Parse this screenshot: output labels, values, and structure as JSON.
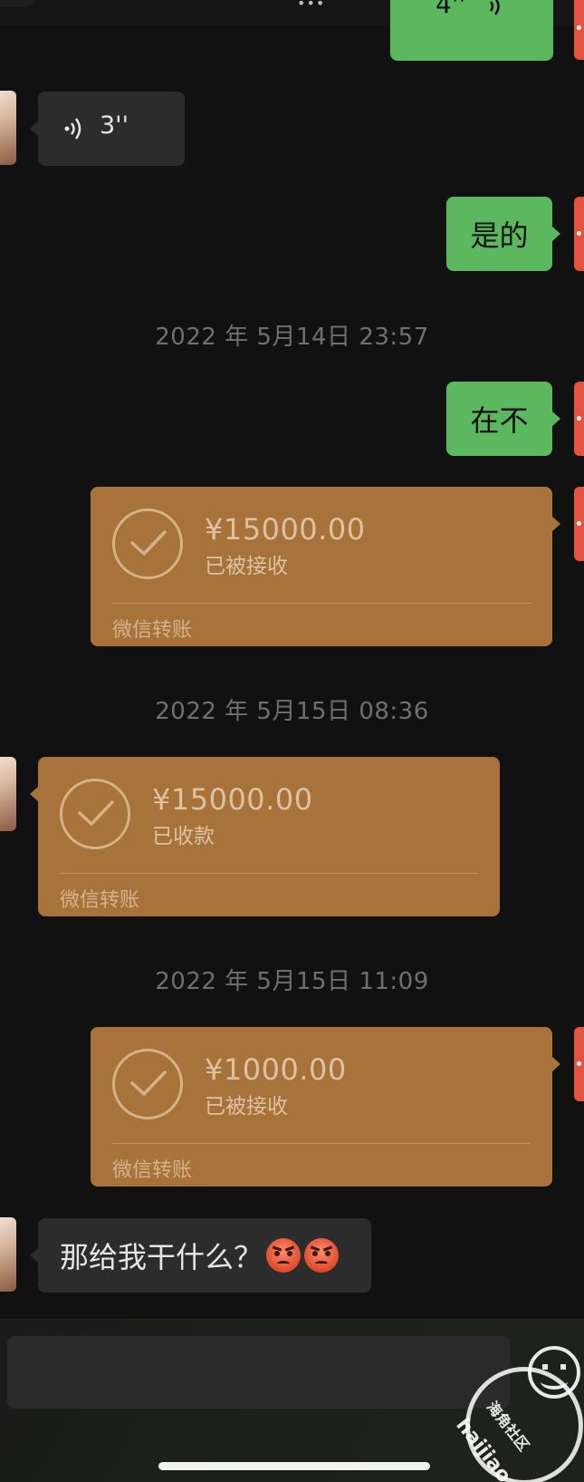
{
  "messages": {
    "top_partial": {
      "text": "4''"
    },
    "voice_in": {
      "duration": "3''"
    },
    "msg_shi_de": {
      "text": "是的"
    },
    "ts1": "2022 年 5月14日 23:57",
    "msg_zai_bu": {
      "text": "在不"
    },
    "transfer1": {
      "amount": "¥15000.00",
      "status": "已被接收",
      "label": "微信转账"
    },
    "ts2": "2022 年 5月15日 08:36",
    "transfer2": {
      "amount": "¥15000.00",
      "status": "已收款",
      "label": "微信转账"
    },
    "ts3": "2022 年 5月15日 11:09",
    "transfer3": {
      "amount": "¥1000.00",
      "status": "已被接收",
      "label": "微信转账"
    },
    "msg_last": {
      "text": "那给我干什么？"
    }
  },
  "watermark": {
    "site": "haijiao.com",
    "cn": "海角社区"
  },
  "icons": {
    "voice": "voice-wave-icon",
    "check": "check-circle-icon",
    "emoji": "angry-face-emoji"
  },
  "colors": {
    "background": "#111111",
    "green_bubble": "#5cb85f",
    "gray_bubble": "#2c2c2c",
    "transfer_card": "#a8733a",
    "timestamp": "#6f6f6f"
  }
}
